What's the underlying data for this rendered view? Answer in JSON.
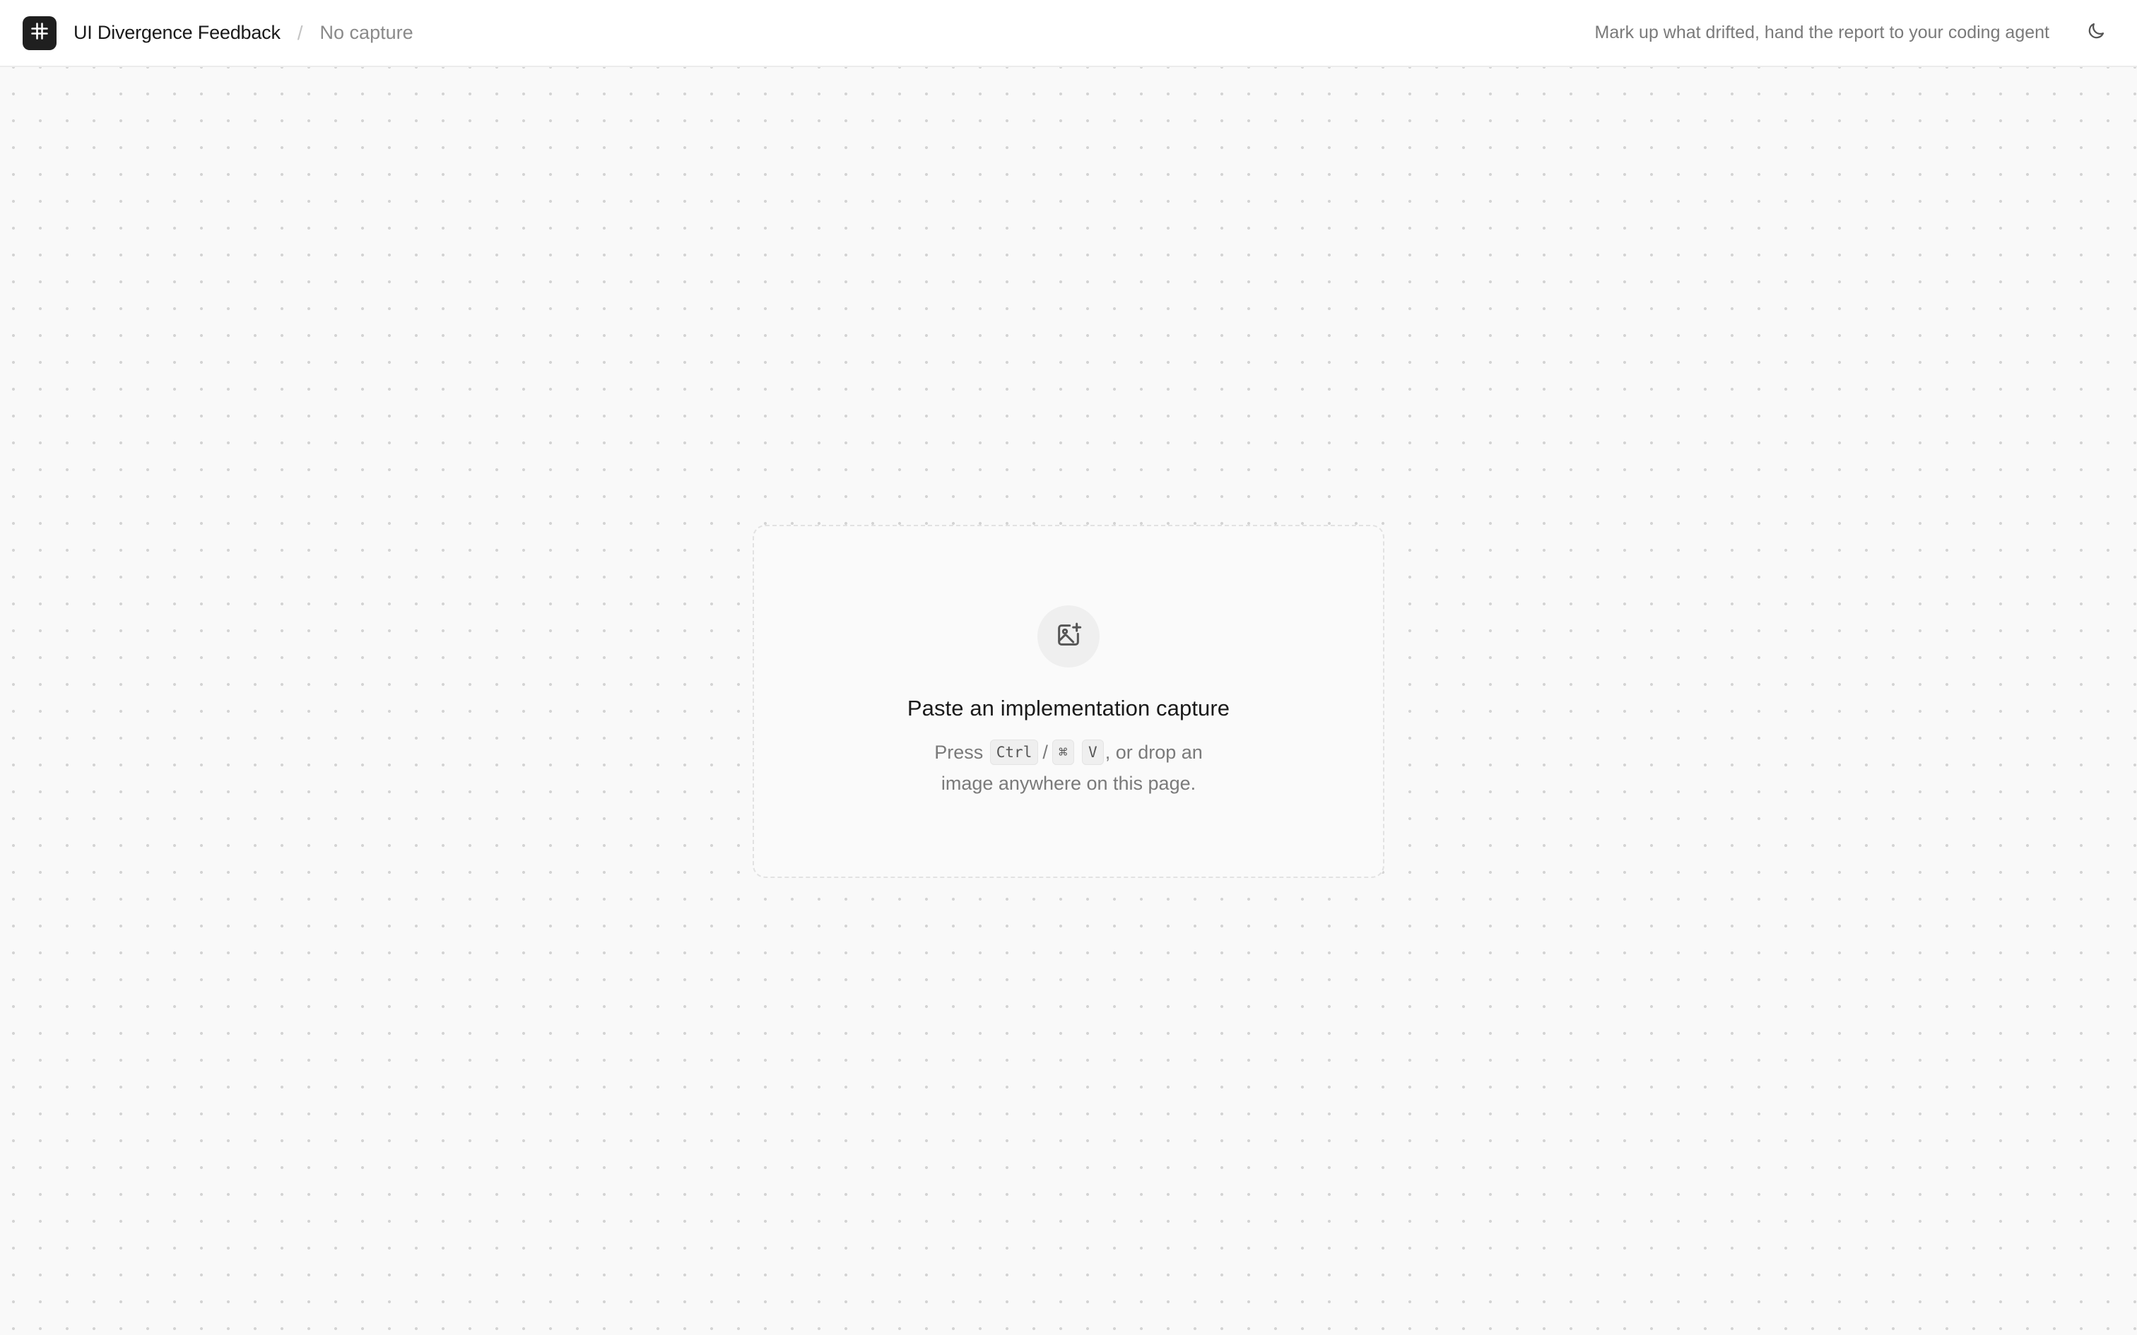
{
  "header": {
    "logo_icon": "hash-grid-icon",
    "app_title": "UI Divergence Feedback",
    "breadcrumb_separator": "/",
    "current_capture": "No capture",
    "tagline": "Mark up what drifted, hand the report to your coding agent",
    "theme_toggle_icon": "moon-icon"
  },
  "dropzone": {
    "icon": "image-plus-icon",
    "title": "Paste an implementation capture",
    "desc_prefix": "Press",
    "key_ctrl": "Ctrl",
    "key_separator": "/",
    "key_cmd": "⌘",
    "key_v": "V",
    "desc_suffix": ", or drop an image anywhere on this page."
  },
  "colors": {
    "background": "#f9f9f9",
    "header_bg": "#ffffff",
    "logo_bg": "#1f1f1f",
    "text_primary": "#1a1a1a",
    "text_muted": "#7a7a7a"
  }
}
